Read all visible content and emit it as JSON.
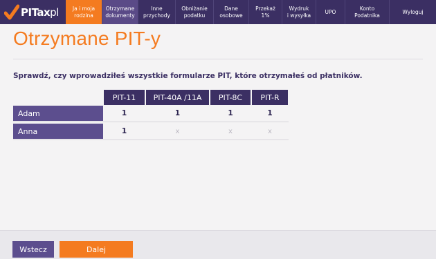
{
  "header": {
    "logo_text_main": "PITax",
    "logo_text_domain": "pl",
    "nav": [
      {
        "label": "Ja i moja\nrodzina",
        "active": "orange"
      },
      {
        "label": "Otrzymane\ndokumenty",
        "active": "purple"
      },
      {
        "label": "Inne\nprzychody",
        "active": ""
      },
      {
        "label": "Obniżanie\npodatku",
        "active": ""
      },
      {
        "label": "Dane\nosobowe",
        "active": ""
      },
      {
        "label": "Przekaż\n1%",
        "active": ""
      },
      {
        "label": "Wydruk\ni wysyłka",
        "active": ""
      },
      {
        "label": "UPO",
        "active": ""
      },
      {
        "label": "Konto\nPodatnika",
        "active": ""
      },
      {
        "label": "Wyloguj",
        "active": ""
      }
    ]
  },
  "main": {
    "title": "Otrzymane PIT-y",
    "lead": "Sprawdź, czy wprowadziłeś wszystkie formularze PIT, które otrzymałeś od płatników.",
    "columns": [
      "PIT-11",
      "PIT-40A /11A",
      "PIT-8C",
      "PIT-R"
    ],
    "rows": [
      {
        "name": "Adam",
        "cells": [
          "1",
          "1",
          "1",
          "1"
        ]
      },
      {
        "name": "Anna",
        "cells": [
          "1",
          "x",
          "x",
          "x"
        ]
      }
    ]
  },
  "footer": {
    "back_label": "Wstecz",
    "next_label": "Dalej"
  },
  "colors": {
    "brand_dark": "#3b2f63",
    "brand_mid": "#5c4e8e",
    "accent_orange": "#f47b20"
  }
}
